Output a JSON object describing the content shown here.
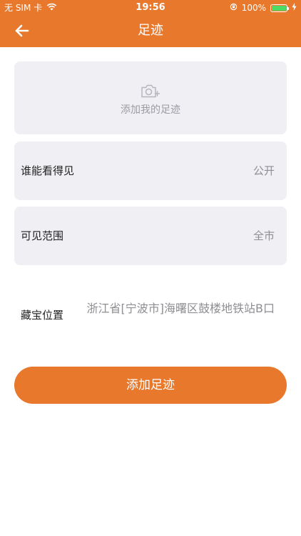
{
  "status_bar": {
    "carrier": "无 SIM 卡",
    "time": "19:56",
    "battery": "100%",
    "battery_level": 1.0,
    "wifi_icon": "wifi-icon",
    "rotation_lock_icon": "rotation-lock-icon",
    "charging_icon": "charging-bolt-icon"
  },
  "header": {
    "title": "足迹",
    "back_icon": "arrow-left-icon"
  },
  "photo": {
    "label": "添加我的足迹",
    "icon": "camera-add-icon"
  },
  "visibility": {
    "label": "谁能看得见",
    "value": "公开"
  },
  "range": {
    "label": "可见范围",
    "value": "全市"
  },
  "location": {
    "label": "藏宝位置",
    "value": "浙江省[宁波市]海曙区鼓楼地铁站B口"
  },
  "submit": {
    "label": "添加足迹"
  },
  "colors": {
    "brand": "#E8782B",
    "card_bg": "#EFEFF4",
    "muted_text": "#8E8E93"
  }
}
